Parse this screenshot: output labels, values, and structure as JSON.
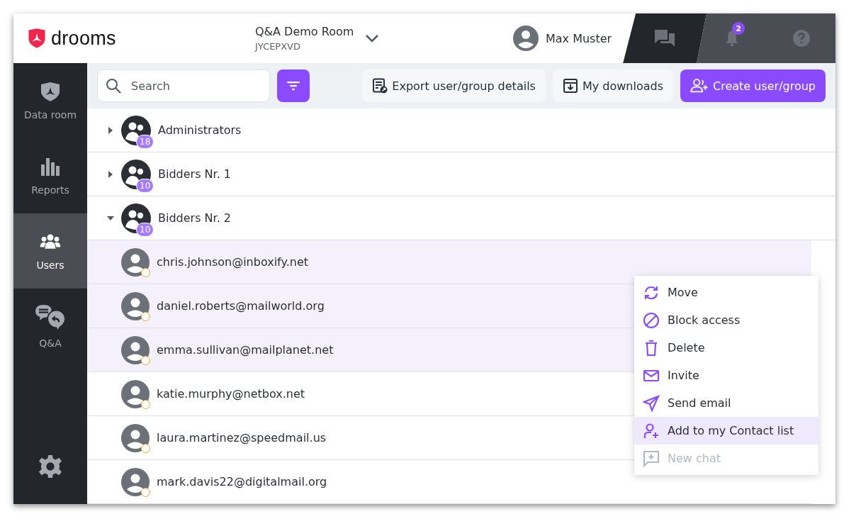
{
  "header": {
    "logo_text": "drooms",
    "room": {
      "name": "Q&A Demo Room",
      "code": "JYCEPXVD"
    },
    "user": {
      "name": "Max Muster"
    },
    "notifications": {
      "count": "2"
    }
  },
  "sidebar": {
    "items": [
      {
        "label": "Data room",
        "selected": false
      },
      {
        "label": "Reports",
        "selected": false
      },
      {
        "label": "Users",
        "selected": true
      },
      {
        "label": "Q&A",
        "selected": false
      }
    ]
  },
  "toolbar": {
    "search": {
      "placeholder": "Search"
    },
    "buttons": [
      {
        "label": "Export user/group details",
        "kind": "export"
      },
      {
        "label": "My downloads",
        "kind": "downloads"
      },
      {
        "label": "Create user/group",
        "kind": "create"
      }
    ]
  },
  "rows": [
    {
      "kind": "group",
      "name": "Administrators",
      "count": "18",
      "expanded": false,
      "selected": false
    },
    {
      "kind": "group",
      "name": "Bidders Nr. 1",
      "count": "10",
      "expanded": false,
      "selected": false
    },
    {
      "kind": "group",
      "name": "Bidders Nr. 2",
      "count": "10",
      "expanded": true,
      "selected": false
    },
    {
      "kind": "user",
      "name": "chris.johnson@inboxify.net",
      "selected": true
    },
    {
      "kind": "user",
      "name": "daniel.roberts@mailworld.org",
      "selected": true
    },
    {
      "kind": "user",
      "name": "emma.sullivan@mailplanet.net",
      "selected": true
    },
    {
      "kind": "user",
      "name": "katie.murphy@netbox.net",
      "selected": false
    },
    {
      "kind": "user",
      "name": "laura.martinez@speedmail.us",
      "selected": false
    },
    {
      "kind": "user",
      "name": "mark.davis22@digitalmail.org",
      "selected": false
    }
  ],
  "context_menu": {
    "items": [
      {
        "label": "Move",
        "selected": false,
        "disabled": false
      },
      {
        "label": "Block access",
        "selected": false,
        "disabled": false
      },
      {
        "label": "Delete",
        "selected": false,
        "disabled": false
      },
      {
        "label": "Invite",
        "selected": false,
        "disabled": false
      },
      {
        "label": "Send email",
        "selected": false,
        "disabled": false
      },
      {
        "label": "Add to my Contact list",
        "selected": true,
        "disabled": false
      },
      {
        "label": "New chat",
        "selected": false,
        "disabled": true
      }
    ]
  }
}
